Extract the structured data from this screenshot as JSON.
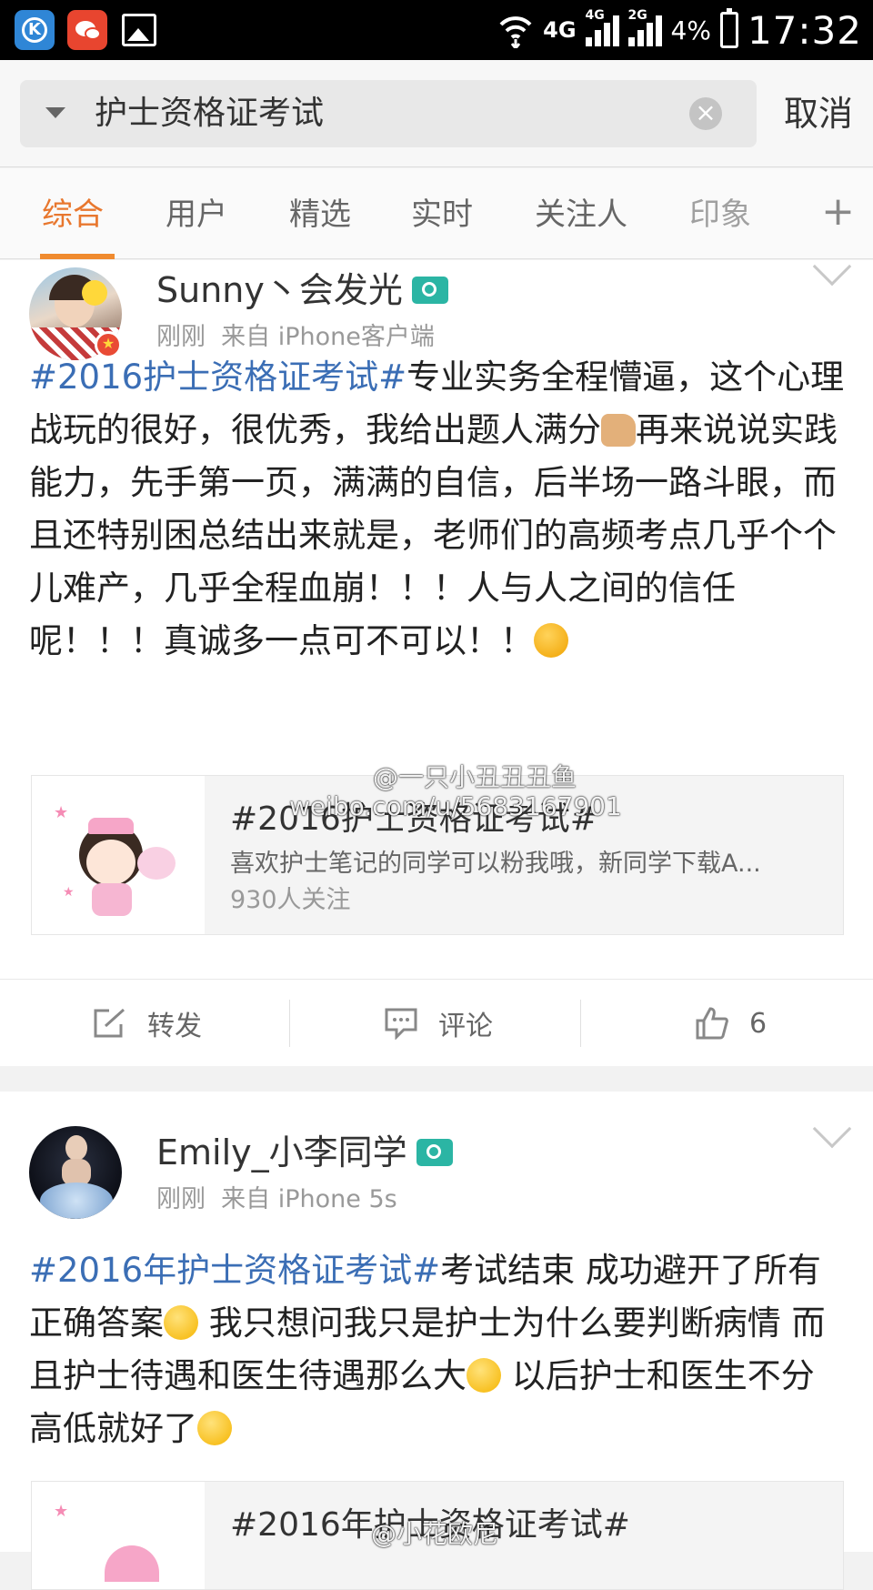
{
  "status_bar": {
    "network_wifi": "4G",
    "network_sim1": "4G",
    "network_sim2": "2G",
    "battery": "4%",
    "time": "17:32",
    "apps": [
      "k-app-icon",
      "wechat-icon",
      "gallery-icon"
    ]
  },
  "search": {
    "query": "护士资格证考试",
    "cancel_label": "取消"
  },
  "tabs": [
    {
      "label": "综合",
      "active": true
    },
    {
      "label": "用户",
      "active": false
    },
    {
      "label": "精选",
      "active": false
    },
    {
      "label": "实时",
      "active": false
    },
    {
      "label": "关注人",
      "active": false
    },
    {
      "label": "印象",
      "active": false
    }
  ],
  "posts": [
    {
      "user": "Sunny丶会发光",
      "time": "刚刚",
      "source": "来自 iPhone客户端",
      "hashtag": "#2016护士资格证考试#",
      "text_1": "专业实务全程懵逼，这个心理战玩的很好，很优秀，我给出题人满分",
      "text_2": "再来说说实践能力，先手第一页，满满的自信，后半场一路斗眼，而且还特别困",
      "text_3": "总结出来就是，老师们的高频考点几乎个个儿难产，几乎全程血崩！！！人与人之间的信任呢！！！真诚多一点可不可以！！",
      "repost": {
        "title": "#2016护士资格证考试#",
        "desc": "喜欢护士笔记的同学可以粉我哦，新同学下载A...",
        "fans": "930人关注"
      },
      "actions": {
        "repost": "转发",
        "comment": "评论",
        "like": "6"
      }
    },
    {
      "user": "Emily_小李同学",
      "time": "刚刚",
      "source": "来自 iPhone 5s",
      "hashtag": "#2016年护士资格证考试#",
      "text_1": "考试结束 成功避开了所有正确答案",
      "text_2": " 我只想问我只是护士为什么要判断病情  而且护士待遇和医生待遇那么大",
      "text_3": " 以后护士和医生不分高低就好了",
      "repost": {
        "title": "#2016年护士资格证考试#"
      }
    }
  ],
  "watermarks": {
    "line1": "@一只小丑丑丑鱼",
    "line2": "weibo.com/u/5683167901",
    "bottom": "@小花欧尼"
  },
  "colors": {
    "accent": "#e8772e",
    "hashtag": "#3b6eb5",
    "verified": "#2bb5a4"
  }
}
